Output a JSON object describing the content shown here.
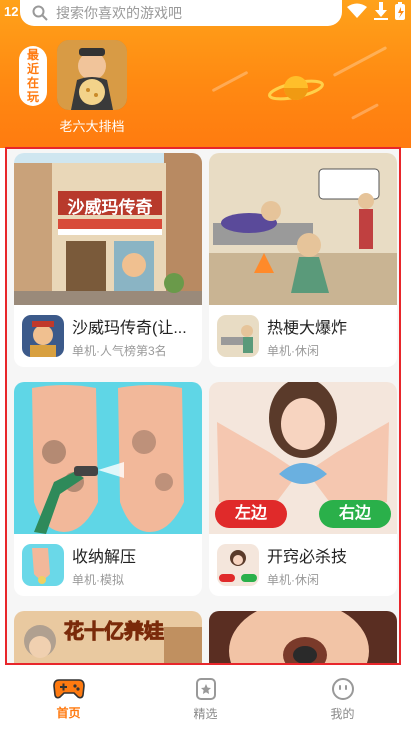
{
  "status": {
    "time": "12"
  },
  "search": {
    "placeholder": "搜索你喜欢的游戏吧"
  },
  "recent": {
    "tag_lines": [
      "最",
      "近",
      "在",
      "玩"
    ],
    "game_name": "老六大排档"
  },
  "games": [
    {
      "name": "沙威玛传奇(让...",
      "subtitle": "单机·人气榜第3名",
      "art_text": "沙威玛传奇"
    },
    {
      "name": "热梗大爆炸",
      "subtitle": "单机·休闲"
    },
    {
      "name": "收纳解压",
      "subtitle": "单机·模拟"
    },
    {
      "name": "开窍必杀技",
      "subtitle": "单机·休闲",
      "art_left": "左边",
      "art_right": "右边"
    },
    {
      "name": "花十亿养娃",
      "subtitle": "",
      "art_text": "花十亿养娃"
    },
    {
      "name": "",
      "subtitle": ""
    }
  ],
  "tabs": [
    {
      "label": "首页",
      "icon": "gamepad-icon",
      "active": true
    },
    {
      "label": "精选",
      "icon": "star-badge-icon",
      "active": false
    },
    {
      "label": "我的",
      "icon": "smiley-icon",
      "active": false
    }
  ],
  "colors": {
    "accent": "#ff7a10",
    "frame": "#e8262b"
  }
}
